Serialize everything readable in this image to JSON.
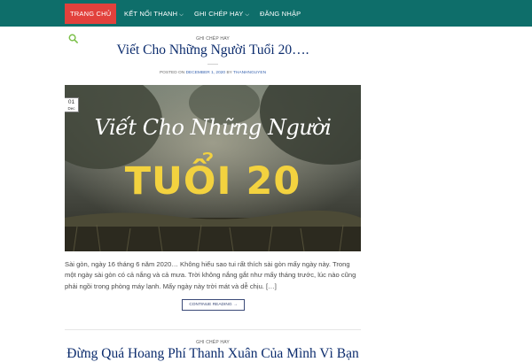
{
  "nav": {
    "items": [
      {
        "label": "Trang chủ",
        "active": true
      },
      {
        "label": "Kết nối thanh",
        "chevron": "chevron-down-icon"
      },
      {
        "label": "Ghi chép hay",
        "chevron": "chevron-down-icon"
      },
      {
        "label": "Đăng nhập"
      }
    ]
  },
  "search": {
    "icon": "search-icon"
  },
  "posts": [
    {
      "category": "Ghi chép hay",
      "title": "Viết Cho Những Người Tuổi 20….",
      "meta_prefix": "Posted on",
      "date": "December 1, 2020",
      "meta_by": "by",
      "author": "thanhnguyen",
      "badge_day": "01",
      "badge_month": "Dec",
      "image_title_line1": "Viết Cho Những Người",
      "image_title_line2": "TUỔI 20",
      "excerpt": "Sài gòn, ngày 16 tháng 6 năm 2020… Không hiểu sao tui rất thích sài gòn mấy ngày này. Trong một ngày sài gòn có cả nắng và cả mưa. Trời không nắng gắt như mấy tháng trước, lúc nào cũng phải ngồi trong phòng máy lạnh.  Mấy ngày này trời mát và dễ chịu. […]",
      "read_more": "Continue reading →"
    },
    {
      "category": "Ghi chép hay",
      "title": "Đừng Quá Hoang Phí Thanh Xuân Của Mình Vì Bạn"
    }
  ],
  "colors": {
    "topbar": "#0e6e6a",
    "active": "#e2413c",
    "title": "#0d2d6e",
    "accent_yellow": "#f3d23f",
    "search": "#7cc04a"
  }
}
